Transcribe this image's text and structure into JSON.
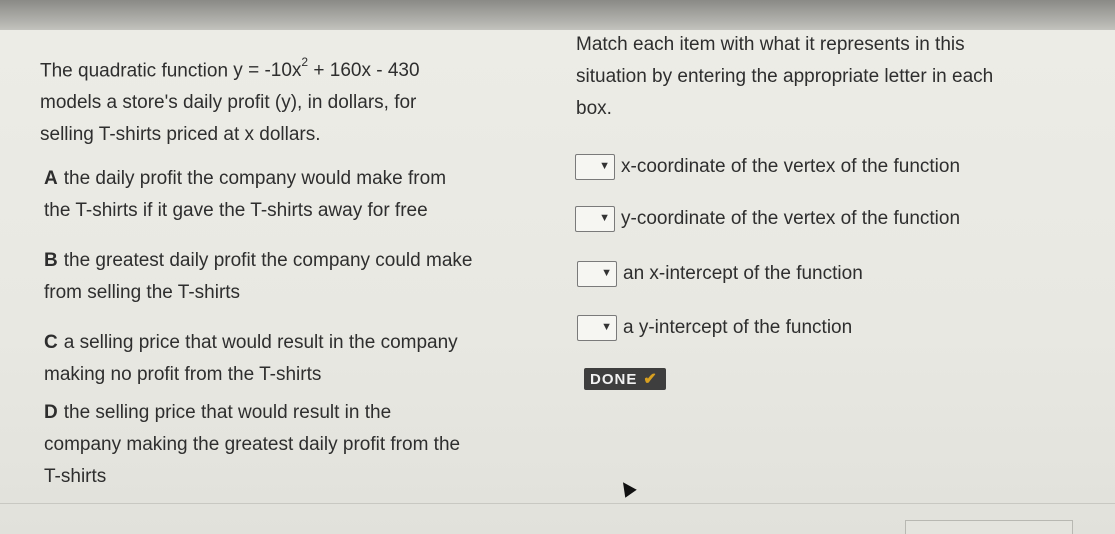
{
  "problem": {
    "intro_lines": [
      "The quadratic function ",
      "models a store's daily profit (y), in dollars, for",
      "selling T-shirts priced at x dollars."
    ],
    "equation": {
      "lhs": "y = -10x",
      "exponent": "2",
      "rhs": " + 160x - 430"
    }
  },
  "instructions": {
    "lines": [
      "Match each item with what it represents in this",
      "situation by entering the appropriate letter in each",
      "box."
    ]
  },
  "options": [
    {
      "letter": "A",
      "lines": [
        "the daily profit the company would make from",
        "the T-shirts if it gave the T-shirts away for free"
      ]
    },
    {
      "letter": "B",
      "lines": [
        "the greatest daily profit the company could make",
        "from selling the T-shirts"
      ]
    },
    {
      "letter": "C",
      "lines": [
        "a selling price that would result in the company",
        "making no profit from the T-shirts"
      ]
    },
    {
      "letter": "D",
      "lines": [
        "the selling price that would result in the",
        "company making the greatest daily profit from the",
        "T-shirts"
      ]
    }
  ],
  "matches": [
    {
      "label": "x-coordinate of the vertex of the function",
      "value": ""
    },
    {
      "label": "y-coordinate of the vertex of the function",
      "value": ""
    },
    {
      "label": "an x-intercept of the function",
      "value": ""
    },
    {
      "label": "a y-intercept of the function",
      "value": ""
    }
  ],
  "done_button": {
    "label": "DONE",
    "icon": "check-icon"
  }
}
